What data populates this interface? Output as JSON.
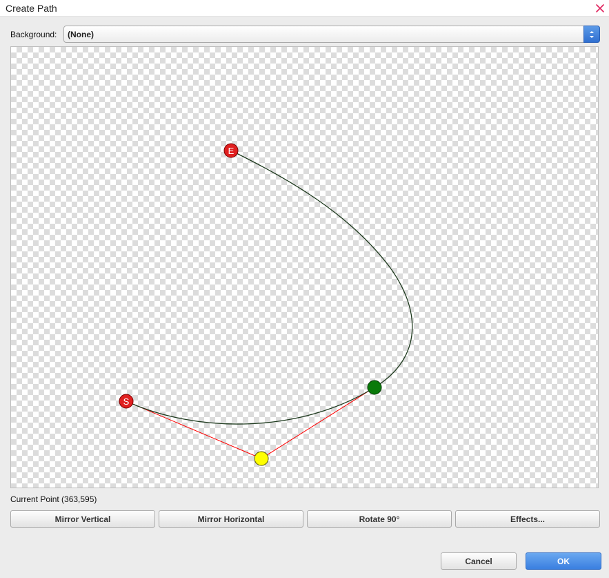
{
  "window": {
    "title": "Create Path",
    "close_icon": "close-icon",
    "close_color": "#e0245e"
  },
  "background": {
    "label": "Background:",
    "selected": "(None)"
  },
  "path_canvas": {
    "start_label": "S",
    "end_label": "E",
    "curve_color": "#1e3a1e",
    "handle_line_color": "#ff0000",
    "anchor_color": "#e02020",
    "control_point_color": "#ffff00",
    "current_point_color": "#0a7a0a"
  },
  "status": {
    "current_point": "Current Point (363,595)"
  },
  "actions": {
    "mirror_vertical": "Mirror Vertical",
    "mirror_horizontal": "Mirror Horizontal",
    "rotate_90": "Rotate 90°",
    "effects": "Effects..."
  },
  "footer": {
    "cancel": "Cancel",
    "ok": "OK"
  }
}
